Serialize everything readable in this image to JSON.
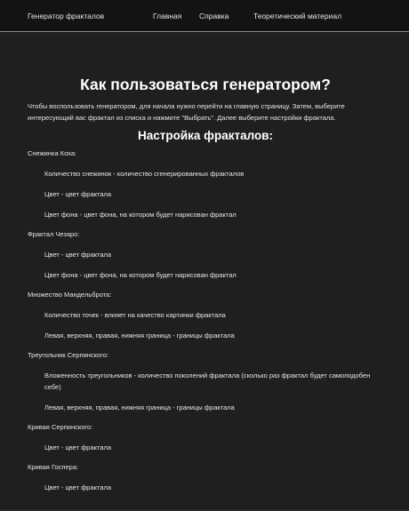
{
  "nav": {
    "brand": "Генератор фракталов",
    "home": "Главная",
    "help": "Справка",
    "theory": "Теоретический материал"
  },
  "page": {
    "title": "Как пользоваться генератором?",
    "intro": "Чтобы воспользовать генератором, для начала нужно перейти на главную страницу. Затем, выберите интересующий вас фрактал из списка и нажмите \"Выбрать\". Далее выберите настройки фрактала.",
    "section_title": "Настройка фракталов:"
  },
  "fractals": [
    {
      "name": "Снежинка Коха:",
      "params": [
        "Количество снежинок - количество сгенерированных фракталов",
        "Цвет - цвет фрактала",
        "Цвет фона - цвет фона, на котором будет нарисован фрактал"
      ]
    },
    {
      "name": "Фрактал Чезаро:",
      "params": [
        "Цвет - цвет фрактала",
        "Цвет фона - цвет фона, на котором будет нарисован фрактал"
      ]
    },
    {
      "name": "Множество Мандельброта:",
      "params": [
        "Количество точек - влияет на качество картинки фрактала",
        "Левая, верхняя, правая, нижняя граница - границы фрактала"
      ]
    },
    {
      "name": "Треугольник Серпинского:",
      "params": [
        "Вложенность треугольников - количество поколений фрактала (сколько раз фрактал будет самоподобен себе)",
        "Левая, верхняя, правая, нижняя граница - границы фрактала"
      ]
    },
    {
      "name": "Кривая Серпинского:",
      "params": [
        "Цвет - цвет фрактала"
      ]
    },
    {
      "name": "Кривая Госпера:",
      "params": [
        "Цвет - цвет фрактала"
      ]
    }
  ]
}
